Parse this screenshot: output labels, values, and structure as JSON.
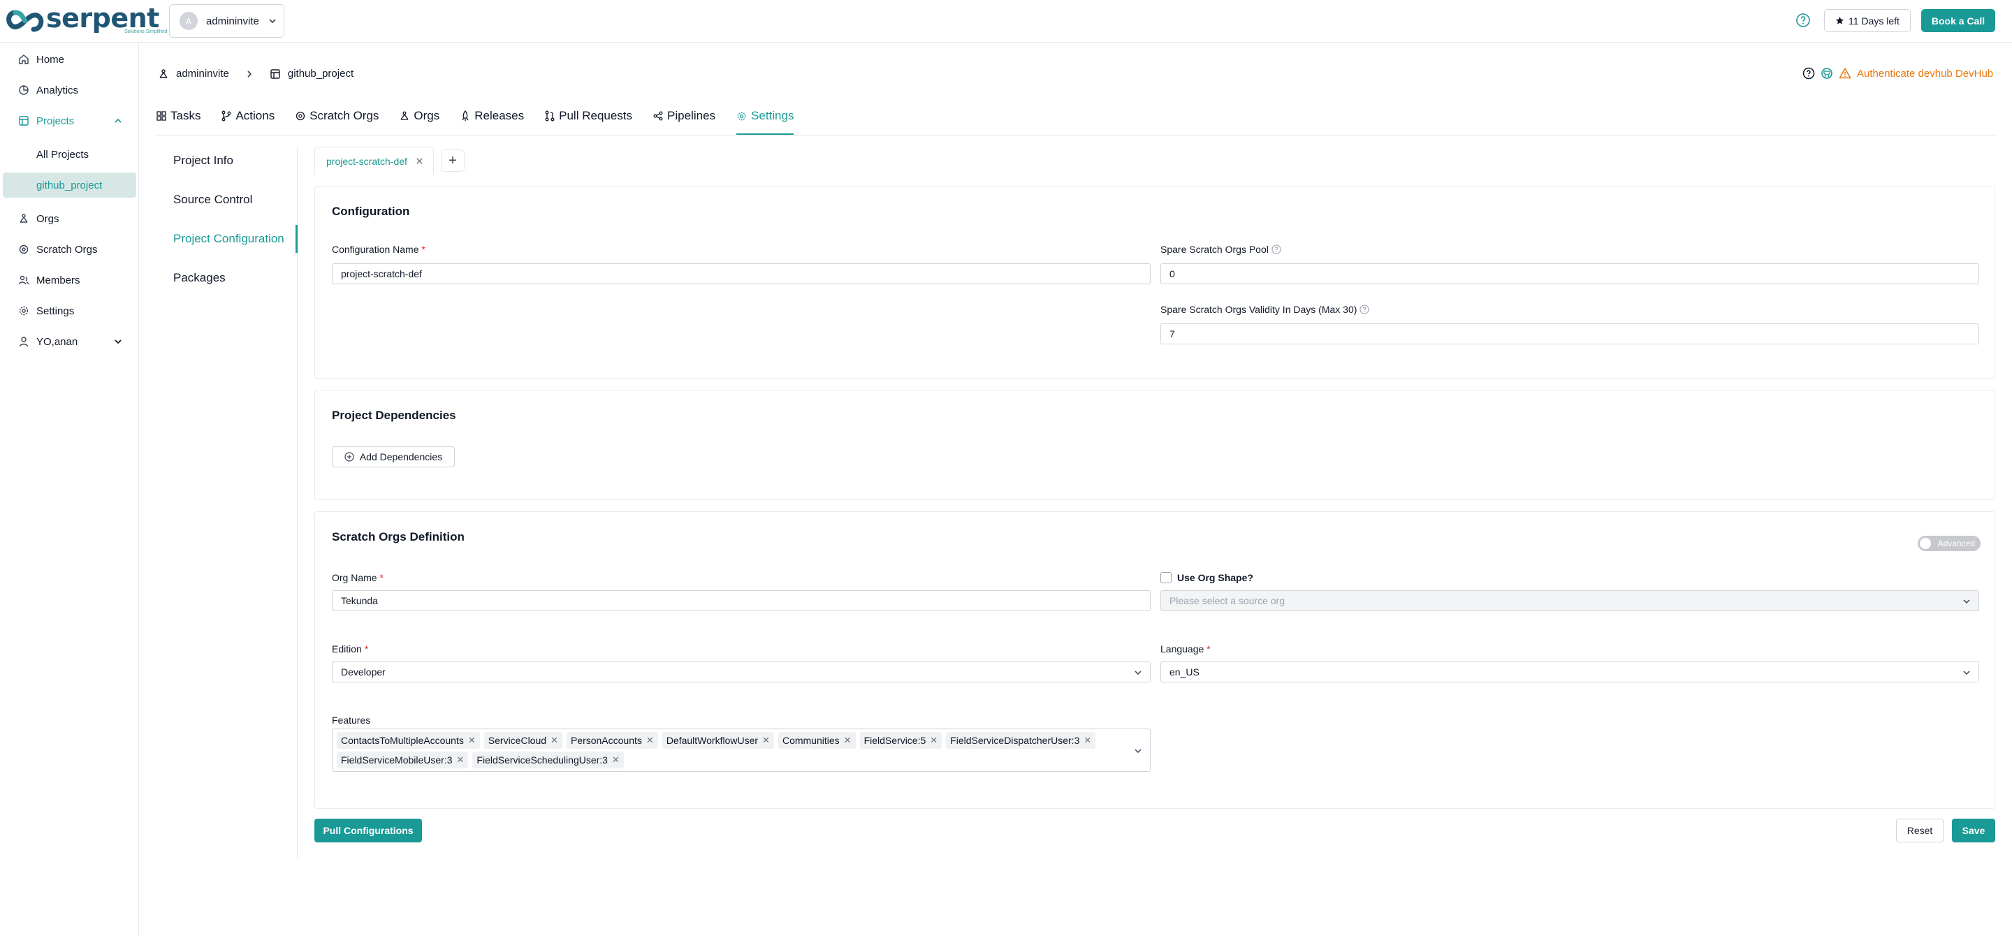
{
  "topbar": {
    "logo_text": "serpent",
    "logo_sub": "Solutions Simplified",
    "org_avatar": "A",
    "org_name": "admininvite",
    "days_left": "11 Days left",
    "book_call": "Book a Call"
  },
  "sidebar": {
    "items": [
      {
        "label": "Home",
        "icon": "home-icon"
      },
      {
        "label": "Analytics",
        "icon": "analytics-icon"
      },
      {
        "label": "Projects",
        "icon": "projects-icon"
      },
      {
        "label": "Orgs",
        "icon": "orgs-icon"
      },
      {
        "label": "Scratch Orgs",
        "icon": "scratch-orgs-icon"
      },
      {
        "label": "Members",
        "icon": "members-icon"
      },
      {
        "label": "Settings",
        "icon": "settings-icon"
      },
      {
        "label": "YO,anan",
        "icon": "user-icon"
      }
    ],
    "sub_items": [
      {
        "label": "All Projects"
      },
      {
        "label": "github_project"
      }
    ]
  },
  "breadcrumb": {
    "org": "admininvite",
    "project": "github_project"
  },
  "header_right": {
    "warning": "Authenticate devhub DevHub"
  },
  "tabs": [
    {
      "label": "Tasks"
    },
    {
      "label": "Actions"
    },
    {
      "label": "Scratch Orgs"
    },
    {
      "label": "Orgs"
    },
    {
      "label": "Releases"
    },
    {
      "label": "Pull Requests"
    },
    {
      "label": "Pipelines"
    },
    {
      "label": "Settings"
    }
  ],
  "settings_menu": [
    {
      "label": "Project Info"
    },
    {
      "label": "Source Control"
    },
    {
      "label": "Project Configuration"
    },
    {
      "label": "Packages"
    }
  ],
  "config_tab": {
    "label": "project-scratch-def",
    "add": "+"
  },
  "configuration": {
    "title": "Configuration",
    "name_label": "Configuration Name",
    "name_value": "project-scratch-def",
    "pool_label": "Spare Scratch Orgs Pool",
    "pool_value": "0",
    "validity_label": "Spare Scratch Orgs Validity In Days (Max 30)",
    "validity_value": "7"
  },
  "dependencies": {
    "title": "Project Dependencies",
    "add_button": "Add Dependencies"
  },
  "scratch_def": {
    "title": "Scratch Orgs Definition",
    "advanced_toggle": "Advanced",
    "org_name_label": "Org Name",
    "org_name_value": "Tekunda",
    "use_shape_label": "Use Org Shape?",
    "source_org_placeholder": "Please select a source org",
    "edition_label": "Edition",
    "edition_value": "Developer",
    "language_label": "Language",
    "language_value": "en_US",
    "features_label": "Features",
    "features": [
      "ContactsToMultipleAccounts",
      "ServiceCloud",
      "PersonAccounts",
      "DefaultWorkflowUser",
      "Communities",
      "FieldService:5",
      "FieldServiceDispatcherUser:3",
      "FieldServiceMobileUser:3",
      "FieldServiceSchedulingUser:3"
    ]
  },
  "footer": {
    "pull_button": "Pull Configurations",
    "reset_button": "Reset",
    "save_button": "Save"
  },
  "colors": {
    "accent": "#1a9a96",
    "warning": "#e8780c"
  }
}
